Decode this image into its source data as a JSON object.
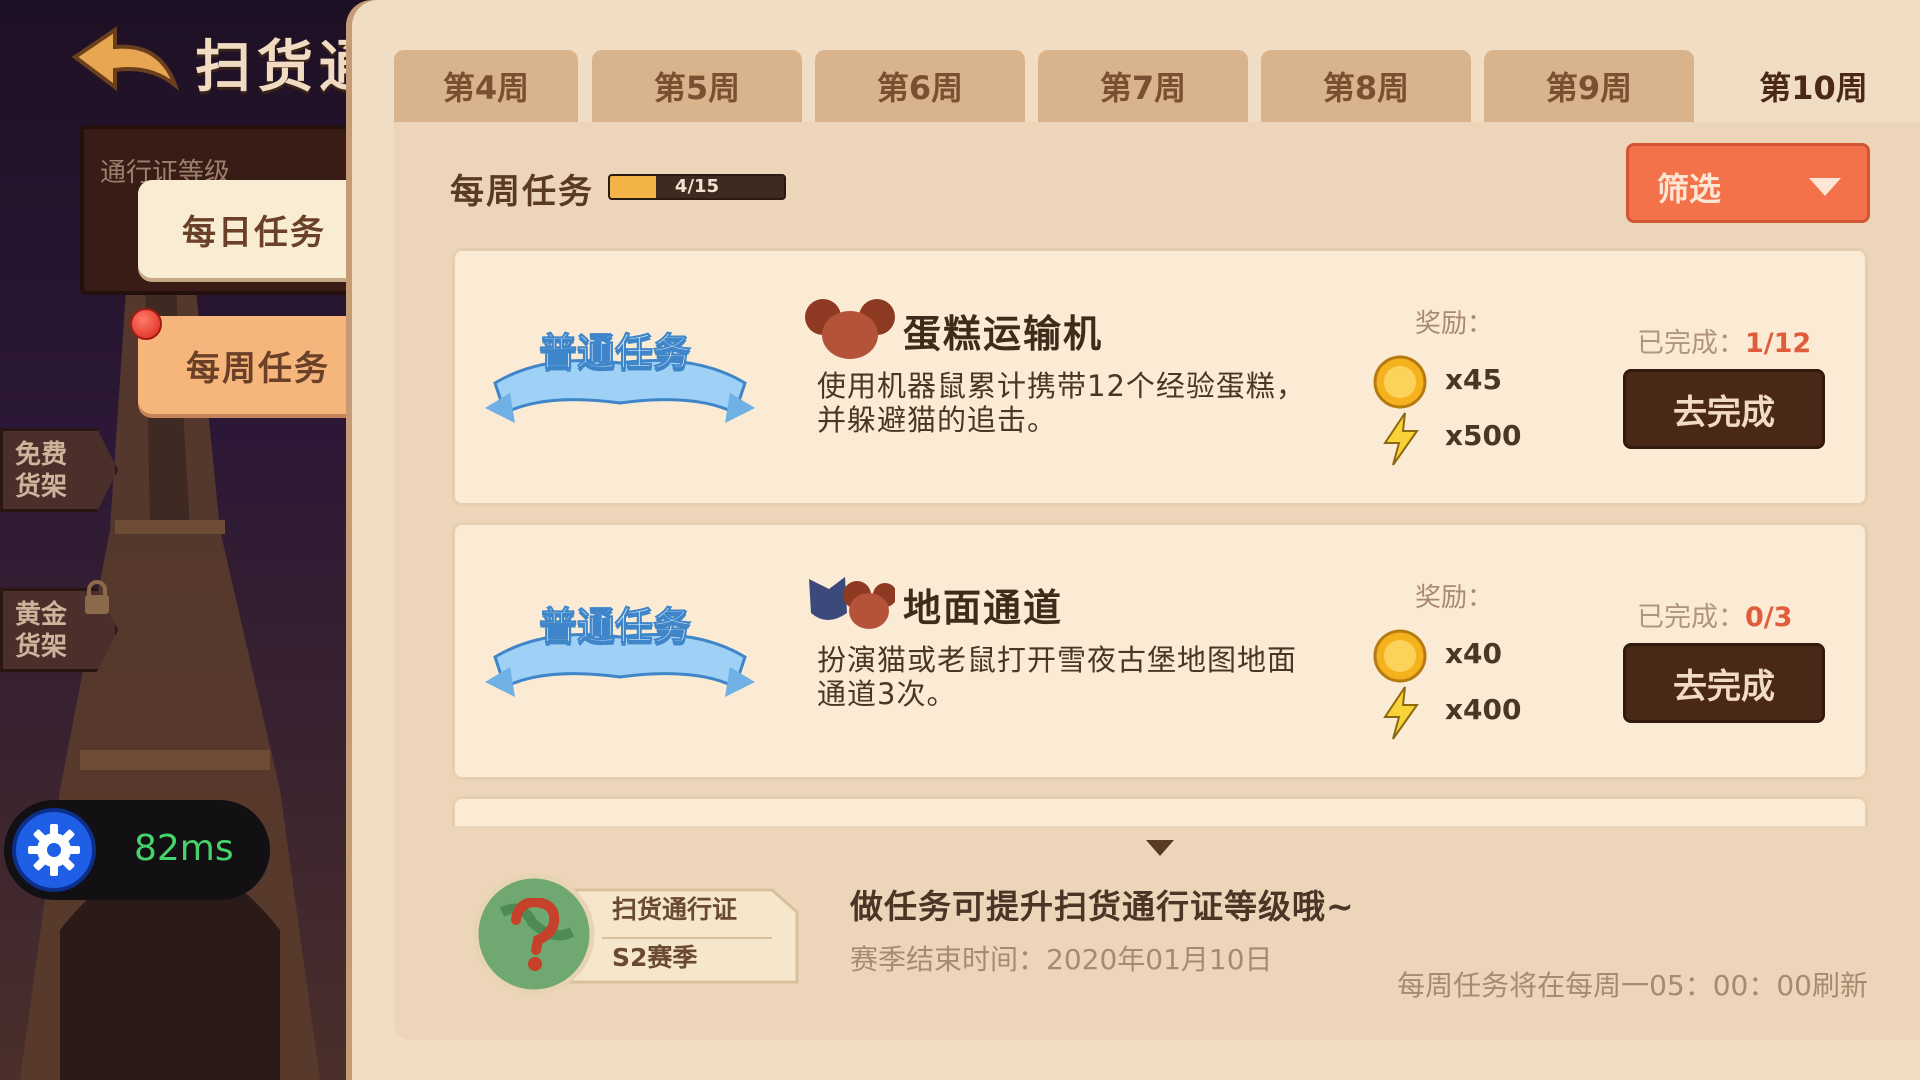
{
  "header": {
    "title": "扫货通",
    "pass_level_label": "通行证等级"
  },
  "side_tabs": {
    "daily": "每日任务",
    "weekly": "每周任务"
  },
  "shops": {
    "free": "免费\n货架",
    "gold": "黄金\n货架"
  },
  "ping": {
    "value": "82ms"
  },
  "week_tabs": [
    {
      "label": "第4周",
      "active": false
    },
    {
      "label": "第5周",
      "active": false
    },
    {
      "label": "第6周",
      "active": false
    },
    {
      "label": "第7周",
      "active": false
    },
    {
      "label": "第8周",
      "active": false
    },
    {
      "label": "第9周",
      "active": false
    },
    {
      "label": "第10周",
      "active": true
    }
  ],
  "weekly": {
    "title": "每周任务",
    "progress_text": "4/15",
    "progress_fraction": 0.267,
    "filter_label": "筛选"
  },
  "tasks": [
    {
      "ribbon": "普通任务",
      "name": "蛋糕运输机",
      "desc": "使用机器鼠累计携带12个经验蛋糕，并躲避猫的追击。",
      "reward_label": "奖励：",
      "coin_reward": "x45",
      "energy_reward": "x500",
      "done_label": "已完成：",
      "done_value": "1/12",
      "button": "去完成",
      "icon": "mouse-head-icon"
    },
    {
      "ribbon": "普通任务",
      "name": "地面通道",
      "desc": "扮演猫或老鼠打开雪夜古堡地图地面通道3次。",
      "reward_label": "奖励：",
      "coin_reward": "x40",
      "energy_reward": "x400",
      "done_label": "已完成：",
      "done_value": "0/3",
      "button": "去完成",
      "icon": "cat-and-mouse-icon"
    }
  ],
  "footer": {
    "pass_name": "扫货通行证",
    "season": "S2赛季",
    "hint": "做任务可提升扫货通行证等级哦~",
    "season_end": "赛季结束时间：2020年01月10日",
    "refresh": "每周任务将在每周一05：00：00刷新"
  },
  "colors": {
    "panel_bg": "#f1ddc3",
    "tab_bg": "#d9b38c",
    "filter_button": "#f3724a",
    "go_button": "#4a2818",
    "done_value": "#e05c3a",
    "ribbon_blue": "#9fd0f5"
  }
}
